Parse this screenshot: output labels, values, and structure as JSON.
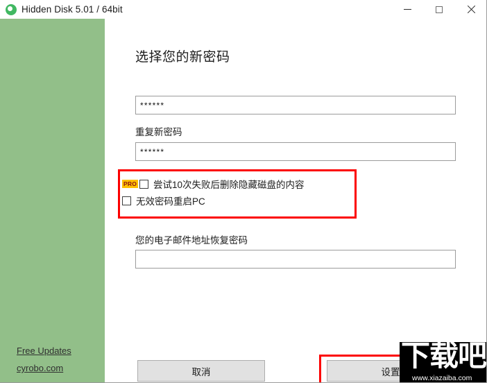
{
  "window": {
    "title": "Hidden Disk 5.01 / 64bit",
    "icon": "green-disk-icon",
    "controls": {
      "minimize": "minimize-icon",
      "maximize": "maximize-icon",
      "close": "close-icon"
    },
    "accent_color": "#92bf89",
    "highlight_color": "#fc0000"
  },
  "sidebar": {
    "background_color": "#92bf89",
    "links": [
      {
        "label": "Free Updates"
      },
      {
        "label": "cyrobo.com"
      }
    ]
  },
  "main": {
    "title": "选择您的新密码",
    "password": {
      "value": "******",
      "placeholder": ""
    },
    "repeat": {
      "label": "重复新密码",
      "value": "******",
      "placeholder": ""
    },
    "options": [
      {
        "badge": "PRO",
        "label": "尝试10次失败后删除隐藏磁盘的内容",
        "checked": false
      },
      {
        "badge": "",
        "label": "无效密码重启PC",
        "checked": false
      }
    ],
    "email": {
      "label": "您的电子邮件地址恢复密码",
      "value": "",
      "placeholder": ""
    },
    "buttons": {
      "cancel": "取消",
      "set": "设置"
    }
  },
  "watermark": {
    "text": "下载吧",
    "url": "www.xiazaiba.com"
  }
}
